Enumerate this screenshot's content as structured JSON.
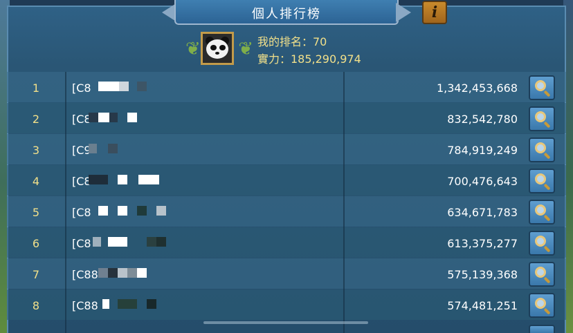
{
  "window": {
    "title": "個人排行榜"
  },
  "info_button": {
    "label": "i"
  },
  "player": {
    "my_rank": "我的排名：70",
    "power": "實力：185,290,974",
    "avatar": "panda-avatar"
  },
  "rankings": [
    {
      "rank": "1",
      "name": "[C8",
      "power": "1,342,453,668"
    },
    {
      "rank": "2",
      "name": "[C8",
      "power": "832,542,780"
    },
    {
      "rank": "3",
      "name": "[C9",
      "power": "784,919,249"
    },
    {
      "rank": "4",
      "name": "[C8",
      "power": "700,476,643"
    },
    {
      "rank": "5",
      "name": "[C8",
      "power": "634,671,783"
    },
    {
      "rank": "6",
      "name": "[C8",
      "power": "613,375,277"
    },
    {
      "rank": "7",
      "name": "[C88",
      "power": "575,139,368"
    },
    {
      "rank": "8",
      "name": "[C88",
      "power": "574,481,251"
    }
  ],
  "colors": {
    "gold_text": "#f2e08a",
    "panel_blue": "#2a5675",
    "accent_blue": "#3f7fb1"
  }
}
